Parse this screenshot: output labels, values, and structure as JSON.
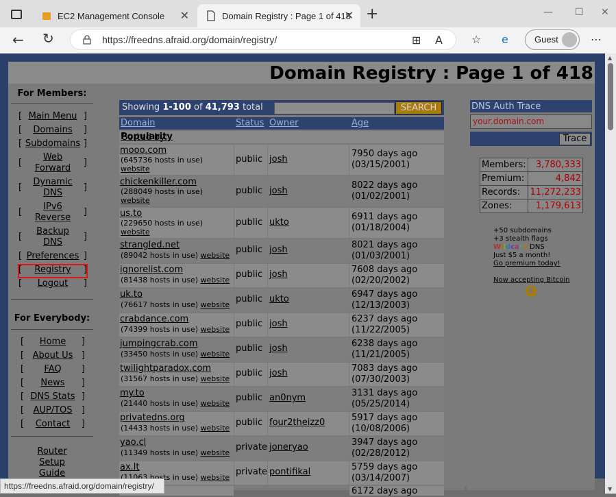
{
  "browser": {
    "tabs": [
      {
        "label": "EC2 Management Console"
      },
      {
        "label": "Domain Registry : Page 1 of 418"
      }
    ],
    "url": "https://freedns.afraid.org/domain/registry/",
    "profile": "Guest",
    "status_url": "https://freedns.afraid.org/domain/registry/"
  },
  "page": {
    "title": "Domain Registry : Page 1 of 418"
  },
  "nav": {
    "members_heading": "For Members:",
    "members": [
      "Main Menu",
      "Domains",
      "Subdomains",
      "Web Forward",
      "Dynamic DNS",
      "IPv6 Reverse",
      "Backup DNS",
      "Preferences",
      "Registry",
      "Logout"
    ],
    "everybody_heading": "For Everybody:",
    "everybody": [
      "Home",
      "About Us",
      "FAQ",
      "News",
      "DNS Stats",
      "AUP/TOS",
      "Contact"
    ],
    "router": "Router Setup Guide"
  },
  "registry": {
    "showing_prefix": "Showing ",
    "showing_range": "1-100",
    "showing_of": " of ",
    "showing_total": "41,793",
    "showing_suffix": " total",
    "search_label": "SEARCH",
    "col_domain": "Domain",
    "col_status": "Status",
    "col_owner": "Owner",
    "col_age": "Age",
    "sorted_by": "Sorted by: ",
    "sorted_value": "Popularity",
    "rows": [
      {
        "domain": "mooo.com",
        "hosts": "(645736 hosts in use)",
        "website": "website",
        "status": "public",
        "owner": "josh",
        "age1": "7950 days ago",
        "age2": "(03/15/2001)"
      },
      {
        "domain": "chickenkiller.com",
        "hosts": "(288049 hosts in use)",
        "website": "website",
        "status": "public",
        "owner": "josh",
        "age1": "8022 days ago",
        "age2": "(01/02/2001)"
      },
      {
        "domain": "us.to",
        "hosts": "(229650 hosts in use)",
        "website": "website",
        "status": "public",
        "owner": "ukto",
        "age1": "6911 days ago",
        "age2": "(01/18/2004)"
      },
      {
        "domain": "strangled.net",
        "hosts": "(89042 hosts in use)",
        "website": "website",
        "status": "public",
        "owner": "josh",
        "age1": "8021 days ago",
        "age2": "(01/03/2001)"
      },
      {
        "domain": "ignorelist.com",
        "hosts": "(81438 hosts in use)",
        "website": "website",
        "status": "public",
        "owner": "josh",
        "age1": "7608 days ago",
        "age2": "(02/20/2002)"
      },
      {
        "domain": "uk.to",
        "hosts": "(76617 hosts in use)",
        "website": "website",
        "status": "public",
        "owner": "ukto",
        "age1": "6947 days ago",
        "age2": "(12/13/2003)"
      },
      {
        "domain": "crabdance.com",
        "hosts": "(74399 hosts in use)",
        "website": "website",
        "status": "public",
        "owner": "josh",
        "age1": "6237 days ago",
        "age2": "(11/22/2005)"
      },
      {
        "domain": "jumpingcrab.com",
        "hosts": "(33450 hosts in use)",
        "website": "website",
        "status": "public",
        "owner": "josh",
        "age1": "6238 days ago",
        "age2": "(11/21/2005)"
      },
      {
        "domain": "twilightparadox.com",
        "hosts": "(31567 hosts in use)",
        "website": "website",
        "status": "public",
        "owner": "josh",
        "age1": "7083 days ago",
        "age2": "(07/30/2003)"
      },
      {
        "domain": "my.to",
        "hosts": "(21440 hosts in use)",
        "website": "website",
        "status": "public",
        "owner": "an0nym",
        "age1": "3131 days ago",
        "age2": "(05/25/2014)"
      },
      {
        "domain": "privatedns.org",
        "hosts": "(14433 hosts in use)",
        "website": "website",
        "status": "public",
        "owner": "four2theizz0",
        "age1": "5917 days ago",
        "age2": "(10/08/2006)"
      },
      {
        "domain": "yao.cl",
        "hosts": "(11349 hosts in use)",
        "website": "website",
        "status": "private",
        "owner": "joneryao",
        "age1": "3947 days ago",
        "age2": "(02/28/2012)"
      },
      {
        "domain": "ax.lt",
        "hosts": "(11063 hosts in use)",
        "website": "website",
        "status": "private",
        "owner": "pontifikal",
        "age1": "5759 days ago",
        "age2": "(03/14/2007)"
      }
    ],
    "last_age": "6172 days ago"
  },
  "sidebar": {
    "dns_auth_trace": "DNS Auth Trace",
    "dns_placeholder": "your.domain.com",
    "trace_label": "Trace",
    "stats": [
      {
        "label": "Members:",
        "value": "3,780,333"
      },
      {
        "label": "Premium:",
        "value": "4,842"
      },
      {
        "label": "Records:",
        "value": "11,272,233"
      },
      {
        "label": "Zones:",
        "value": "1,179,613"
      }
    ],
    "promo1": "+50 subdomains",
    "promo2": "+3 stealth flags",
    "promo3_w": "Wildcard",
    "promo3_rest": " DNS",
    "promo4": "Just $5 a month!",
    "promo5": "Go premium today!",
    "bitcoin": "Now accepting Bitcoin",
    "bitcoin_glyph": "B"
  },
  "colors": {
    "accent": "#2d426e",
    "highlight": "#e01616",
    "search_btn": "#a87b0a"
  }
}
